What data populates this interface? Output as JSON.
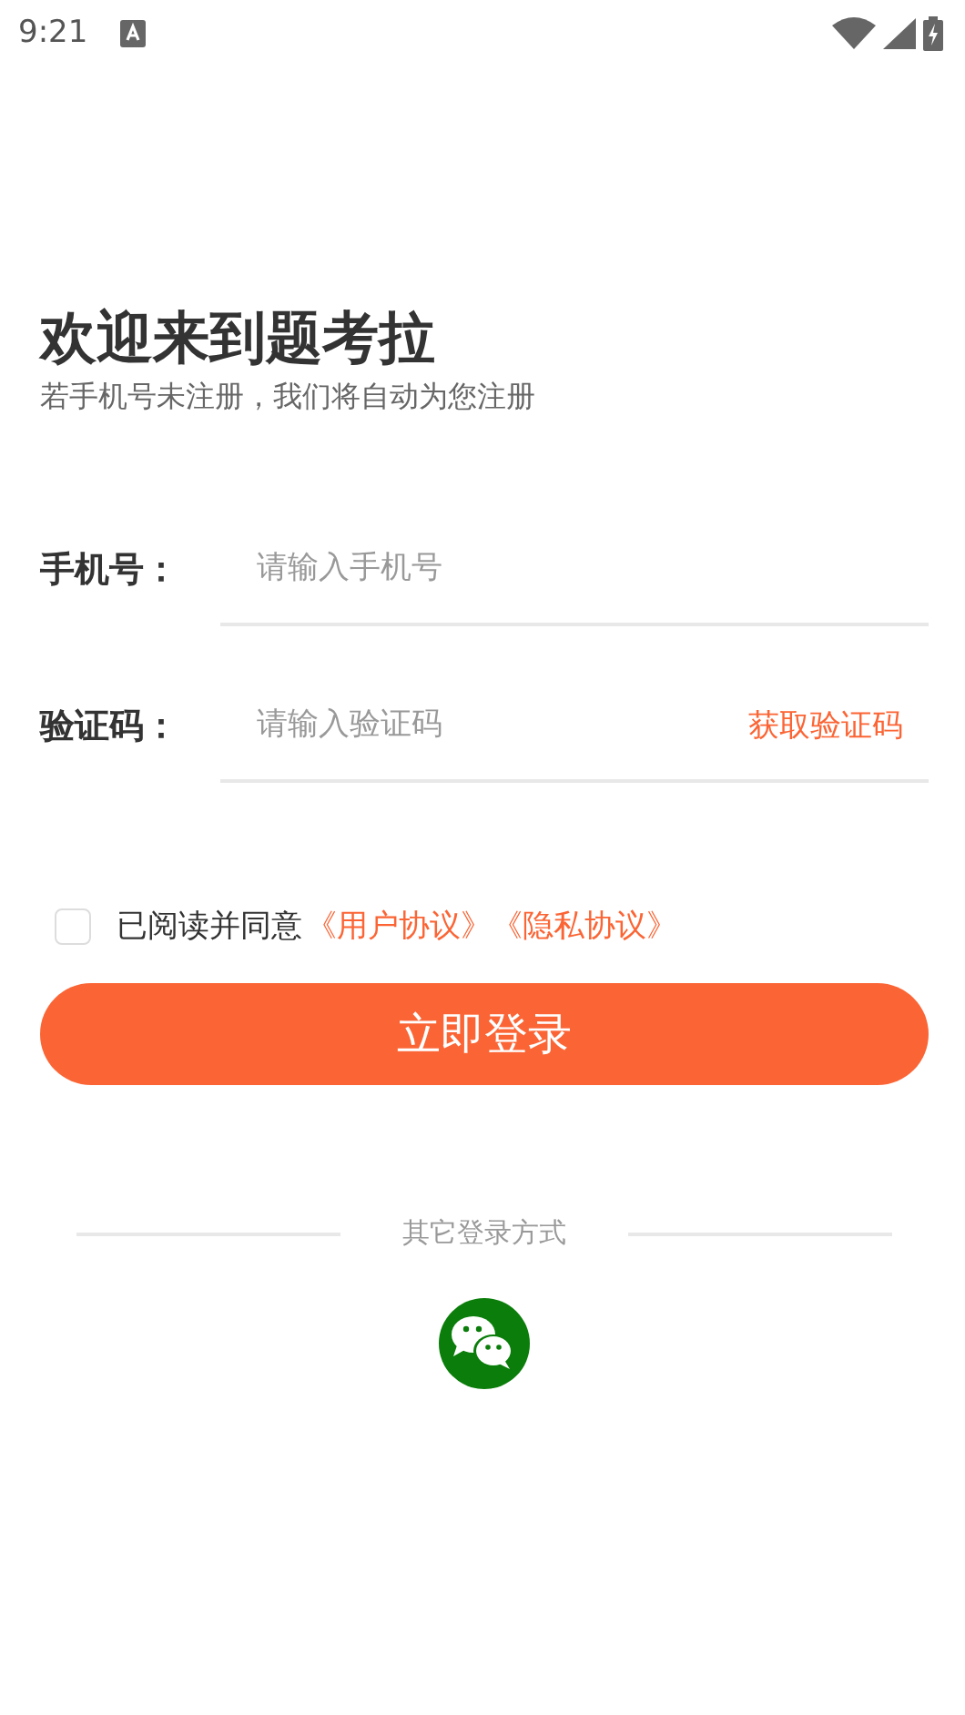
{
  "status_bar": {
    "time": "9:21"
  },
  "header": {
    "title": "欢迎来到题考拉",
    "subtitle": "若手机号未注册，我们将自动为您注册"
  },
  "fields": [
    {
      "label": "手机号：",
      "placeholder": "请输入手机号"
    },
    {
      "label": "验证码：",
      "placeholder": "请输入验证码",
      "action": "获取验证码"
    }
  ],
  "agreement": {
    "checked": false,
    "text": "已阅读并同意",
    "links": [
      "《用户协议》",
      "《隐私协议》"
    ]
  },
  "login_button": "立即登录",
  "other_login": {
    "label": "其它登录方式"
  }
}
